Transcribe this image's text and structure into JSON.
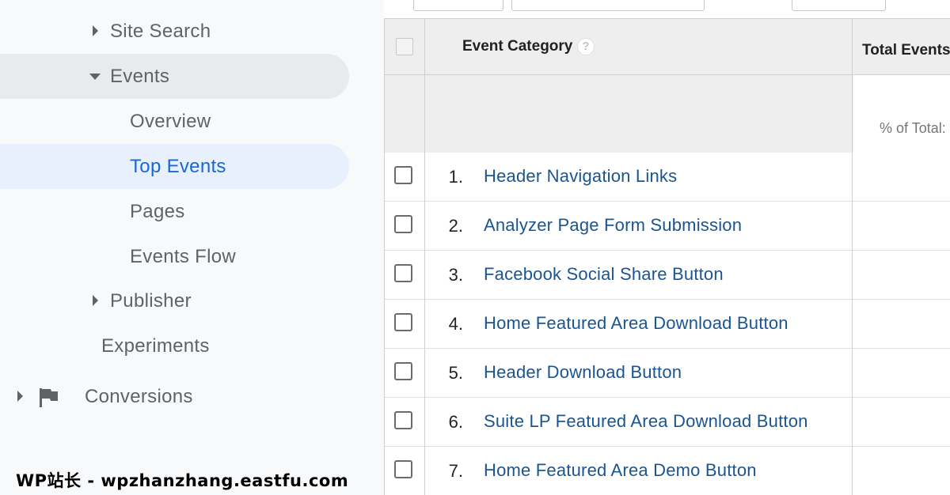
{
  "sidebar": {
    "items": [
      {
        "label": "Site Search",
        "icon": "triangle-right-icon"
      },
      {
        "label": "Events",
        "icon": "triangle-down-icon",
        "expanded": true
      },
      {
        "label": "Overview"
      },
      {
        "label": "Top Events",
        "selected": true
      },
      {
        "label": "Pages"
      },
      {
        "label": "Events Flow"
      },
      {
        "label": "Publisher",
        "icon": "triangle-right-icon"
      },
      {
        "label": "Experiments"
      },
      {
        "label": "Conversions",
        "icon": "flag-icon"
      }
    ]
  },
  "watermark": "WP站长 - wpzhanzhang.eastfu.com",
  "table": {
    "column_event_category": "Event Category",
    "help_label": "?",
    "column_total_events": "Total Events",
    "percent_of_total_label": "% of Total:",
    "rows": [
      {
        "num": "1.",
        "label": "Header Navigation Links"
      },
      {
        "num": "2.",
        "label": "Analyzer Page Form Submission"
      },
      {
        "num": "3.",
        "label": "Facebook Social Share Button"
      },
      {
        "num": "4.",
        "label": "Home Featured Area Download Button"
      },
      {
        "num": "5.",
        "label": "Header Download Button"
      },
      {
        "num": "6.",
        "label": "Suite LP Featured Area Download Button"
      },
      {
        "num": "7.",
        "label": "Home Featured Area Demo Button"
      }
    ]
  },
  "colors": {
    "sidebar_bg": "#f8f9fa",
    "selected_bg": "#e8f0fe",
    "selected_text": "#1967d2",
    "link": "#1a5591"
  }
}
